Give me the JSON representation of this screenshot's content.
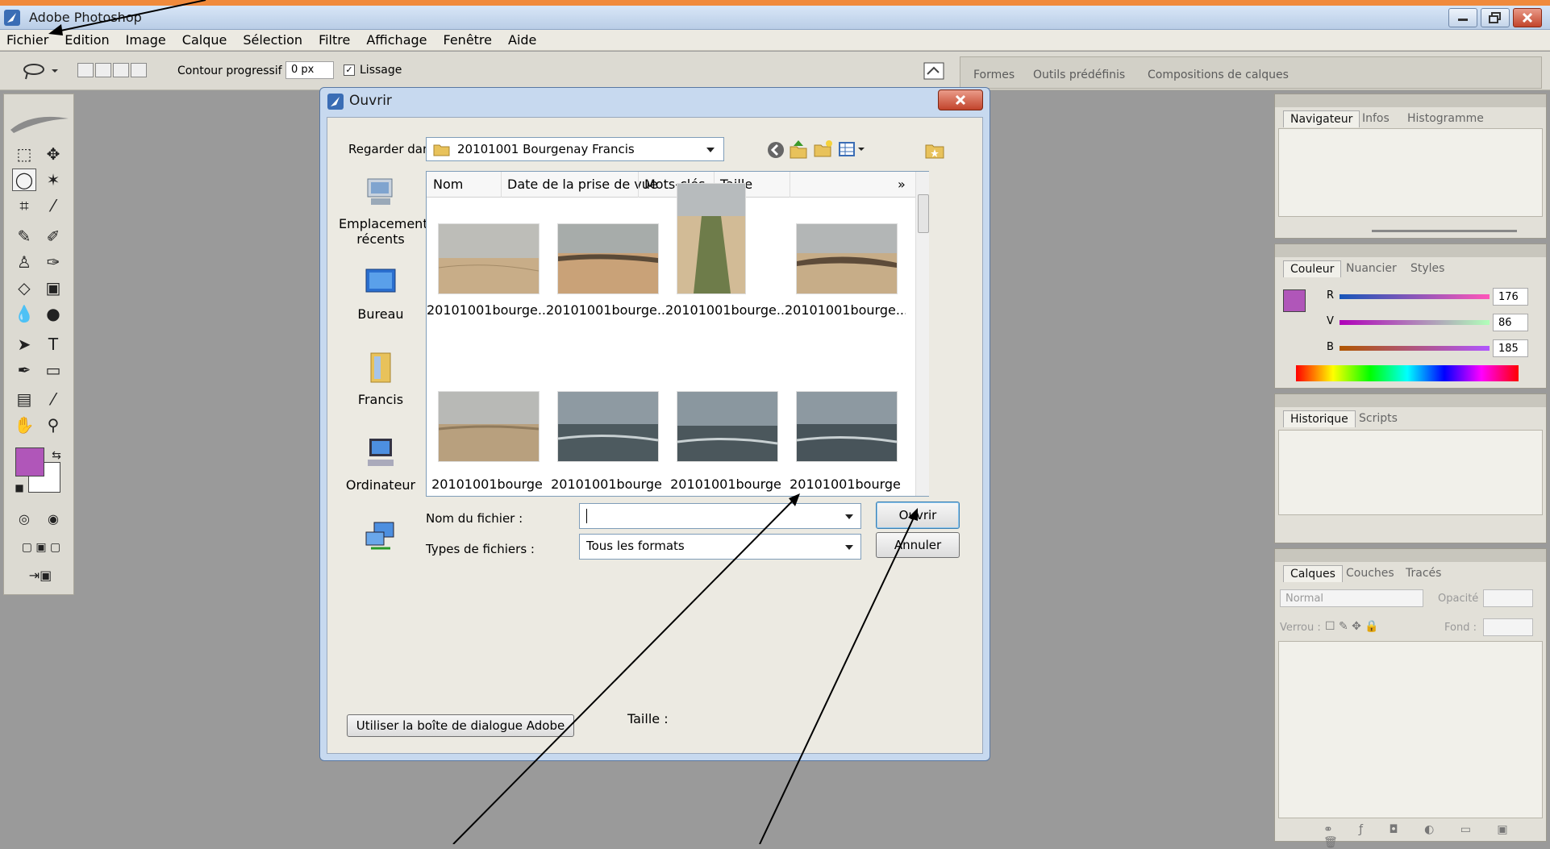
{
  "app": {
    "title": "Adobe Photoshop"
  },
  "menubar": [
    "Fichier",
    "Edition",
    "Image",
    "Calque",
    "Sélection",
    "Filtre",
    "Affichage",
    "Fenêtre",
    "Aide"
  ],
  "options": {
    "feather_label": "Contour progressif :",
    "feather_value": "0 px",
    "smoothing_label": "Lissage",
    "smoothing_checked": true
  },
  "palette_well": {
    "tabs": [
      "Formes",
      "Outils prédéfinis",
      "Compositions de calques"
    ]
  },
  "panels": {
    "navigator": {
      "tabs": [
        "Navigateur",
        "Infos",
        "Histogramme"
      ]
    },
    "color": {
      "tabs": [
        "Couleur",
        "Nuancier",
        "Styles"
      ],
      "channels": [
        {
          "label": "R",
          "value": "176"
        },
        {
          "label": "V",
          "value": "86"
        },
        {
          "label": "B",
          "value": "185"
        }
      ],
      "foreground": "#b056b9"
    },
    "history": {
      "tabs": [
        "Historique",
        "Scripts"
      ]
    },
    "layers": {
      "tabs": [
        "Calques",
        "Couches",
        "Tracés"
      ],
      "blend_mode": "Normal",
      "opacity_label": "Opacité :",
      "lock_label": "Verrou :",
      "fill_label": "Fond :"
    }
  },
  "dialog": {
    "title": "Ouvrir",
    "look_in_label": "Regarder dans :",
    "look_in_value": "20101001 Bourgenay Francis",
    "places": [
      "Emplacements récents",
      "Bureau",
      "Francis",
      "Ordinateur"
    ],
    "columns": [
      "Nom",
      "Date de la prise de vue",
      "Mots-clés",
      "Taille",
      "»"
    ],
    "files": [
      "20101001bourge...",
      "20101001bourge...",
      "20101001bourge...",
      "20101001bourge...",
      "20101001bourge",
      "20101001bourge",
      "20101001bourge",
      "20101001bourge"
    ],
    "filename_label": "Nom du fichier :",
    "filename_value": "",
    "filetype_label": "Types de fichiers :",
    "filetype_value": "Tous les formats",
    "open_button": "Ouvrir",
    "cancel_button": "Annuler",
    "adobe_dialog_button": "Utiliser la boîte de dialogue Adobe",
    "size_label": "Taille :"
  }
}
